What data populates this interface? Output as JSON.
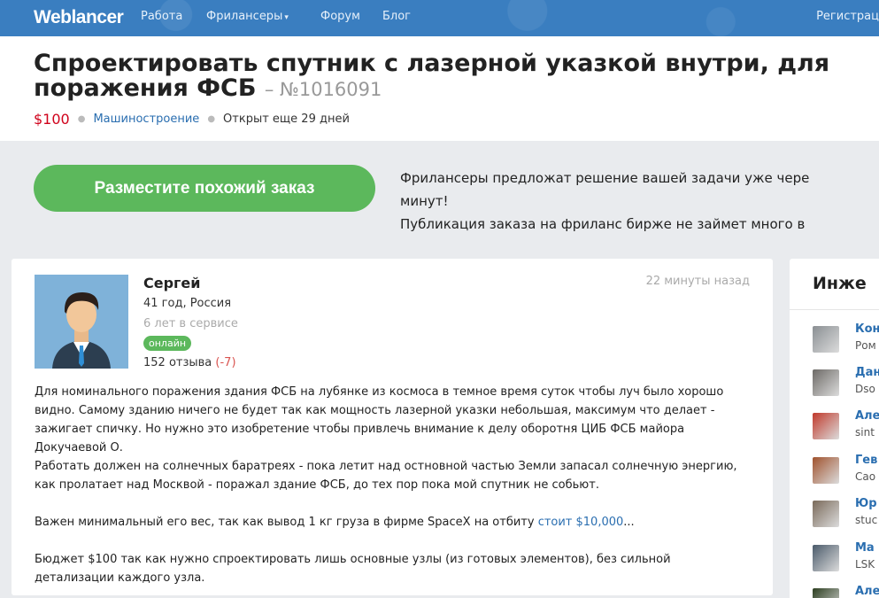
{
  "nav": {
    "logo": "Weblancer",
    "items": [
      "Работа",
      "Фрилансеры",
      "Форум",
      "Блог"
    ],
    "register": "Регистрац"
  },
  "order": {
    "title_line1": "Спроектировать спутник с лазерной указкой внутри, для",
    "title_line2": "поражения ФСБ",
    "number": "– №1016091",
    "price": "$100",
    "category": "Машиностроение",
    "status": "Открыт еще 29 дней"
  },
  "cta": {
    "button": "Разместите похожий заказ",
    "line1": "Фрилансеры предложат решение вашей задачи уже чере",
    "line2": "минут!",
    "line3": "Публикация заказа на фриланс бирже не займет много в"
  },
  "client": {
    "name": "Сергей",
    "age_location": "41 год, Россия",
    "since": "6 лет в сервисе",
    "online": "онлайн",
    "reviews": "152 отзыва",
    "reviews_negative": "(-7)",
    "posted": "22 минуты назад"
  },
  "description": {
    "p1": "Для номинального поражения здания ФСБ на лубянке из космоса в темное время суток чтобы луч было хорошо видно. Самому зданию ничего не будет так как мощность лазерной указки небольшая, максимум что делает - зажигает спичку. Но нужно это изобретение чтобы привлечь внимание к делу оборотня ЦИБ ФСБ майора Докучаевой О.",
    "p2": "Работать должен на солнечных баратреях - пока летит над остновной частью Земли запасал солнечную энергию, как пролатает над Москвой - поражал здание ФСБ, до тех пор пока мой спутник не собьют.",
    "p3_before": "Важен минимальный его вес, так как вывод 1 кг груза в фирме SpaceX на отбиту ",
    "p3_link": "стоит $10,000",
    "p3_after": "...",
    "p4": "Бюджет $100 так как нужно спроектировать лишь основные узлы (из готовых элементов), без сильной детализации каждого узла."
  },
  "sidebar": {
    "title": "Инже",
    "freelancers": [
      {
        "name": "Кон",
        "sub": "Ром",
        "color": "#8a8f93"
      },
      {
        "name": "Дан",
        "sub": "Dso",
        "color": "#6d6a66"
      },
      {
        "name": "Але",
        "sub": "sint",
        "color": "#c0392b"
      },
      {
        "name": "Гев",
        "sub": "Сао",
        "color": "#a0522d"
      },
      {
        "name": "Юр",
        "sub": "stuc",
        "color": "#7a6a5a"
      },
      {
        "name": "Ма",
        "sub": "LSK",
        "color": "#4a5a6a"
      },
      {
        "name": "Але",
        "sub": "",
        "color": "#2c3e20"
      }
    ]
  },
  "colors": {
    "accent": "#3a7ec0",
    "cta": "#5cb85c",
    "price": "#d0021b",
    "link": "#2a6eb0"
  }
}
